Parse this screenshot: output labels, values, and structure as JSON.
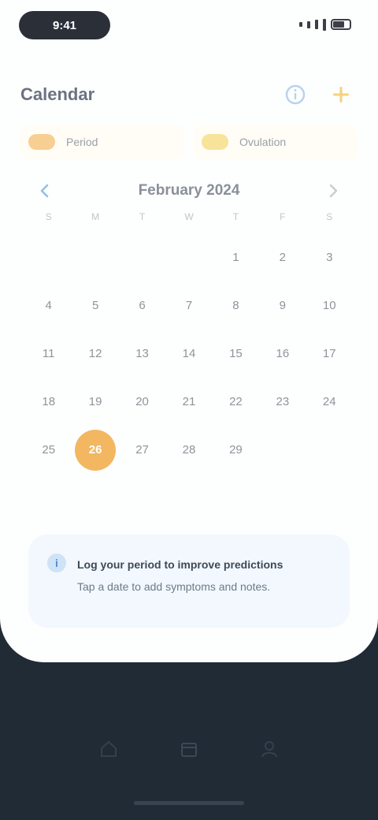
{
  "status": {
    "time": "9:41"
  },
  "header": {
    "title": "Calendar"
  },
  "legend": [
    {
      "label": "Period",
      "color": "#f7cf93"
    },
    {
      "label": "Ovulation",
      "color": "#f7e39a"
    }
  ],
  "calendar": {
    "month_title": "February 2024",
    "weekdays": [
      "S",
      "M",
      "T",
      "W",
      "T",
      "F",
      "S"
    ],
    "leading_blanks": 4,
    "days": [
      "1",
      "2",
      "3",
      "4",
      "5",
      "6",
      "7",
      "8",
      "9",
      "10",
      "11",
      "12",
      "13",
      "14",
      "15",
      "16",
      "17",
      "18",
      "19",
      "20",
      "21",
      "22",
      "23",
      "24",
      "25",
      "26",
      "27",
      "28",
      "29"
    ],
    "today": "26"
  },
  "notice": {
    "title": "Log your period to improve predictions",
    "body": "Tap a date to add symptoms and notes."
  },
  "colors": {
    "accent": "#f3b761",
    "background_dark": "#212b36",
    "info": "#4f8fcf"
  }
}
